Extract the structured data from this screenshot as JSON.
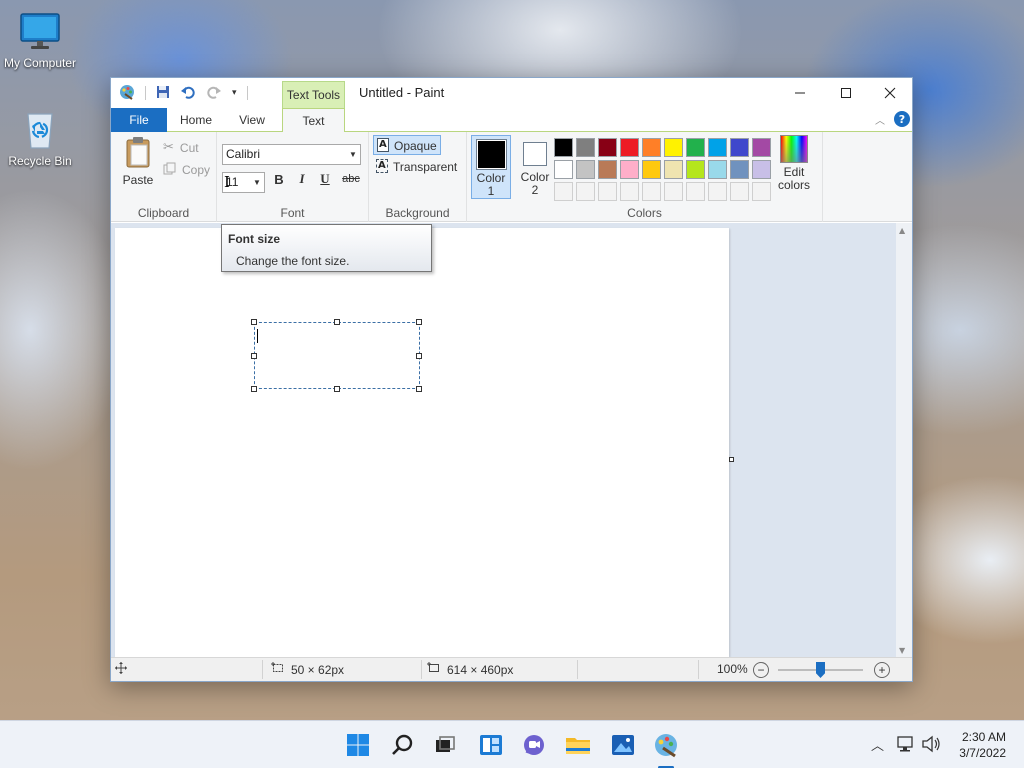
{
  "desktop": {
    "icons": [
      {
        "label": "My Computer"
      },
      {
        "label": "Recycle Bin"
      }
    ]
  },
  "window": {
    "title": "Untitled - Paint",
    "context_tab_group": "Text Tools",
    "tabs": [
      {
        "label": "File"
      },
      {
        "label": "Home"
      },
      {
        "label": "View"
      },
      {
        "label": "Text"
      }
    ],
    "active_tab": "Text"
  },
  "ribbon": {
    "clipboard": {
      "group_label": "Clipboard",
      "paste": "Paste",
      "cut": "Cut",
      "copy": "Copy"
    },
    "font": {
      "group_label": "Font",
      "family": "Calibri",
      "size": "11",
      "bold": "B",
      "italic": "I",
      "underline": "U",
      "strikethrough": "abc"
    },
    "background": {
      "group_label": "Background",
      "opaque": "Opaque",
      "transparent": "Transparent",
      "selected": "Opaque"
    },
    "colors": {
      "group_label": "Colors",
      "color1_label": "Color 1",
      "color1_line1": "Color",
      "color1_line2": "1",
      "color1_value": "#000000",
      "color2_line1": "Color",
      "color2_line2": "2",
      "color2_value": "#ffffff",
      "edit_colors_line1": "Edit",
      "edit_colors_line2": "colors",
      "palette_row1": [
        "#000000",
        "#7f7f7f",
        "#880015",
        "#ed1c24",
        "#ff7f27",
        "#fff200",
        "#22b14c",
        "#00a2e8",
        "#3f48cc",
        "#a349a4"
      ],
      "palette_row2": [
        "#ffffff",
        "#c3c3c3",
        "#b97a57",
        "#ffaec9",
        "#ffc90e",
        "#efe4b0",
        "#b5e61d",
        "#99d9ea",
        "#7092be",
        "#c8bfe7"
      ],
      "palette_row3_empty": 10
    }
  },
  "tooltip": {
    "title": "Font size",
    "description": "Change the font size."
  },
  "statusbar": {
    "selection_size": "50 × 62px",
    "image_size": "614 × 460px",
    "zoom": "100%",
    "zoom_level": 1.0
  },
  "taskbar": {
    "apps": [
      "start",
      "search",
      "task-view",
      "widgets",
      "chat",
      "file-explorer",
      "photos",
      "paint"
    ],
    "time": "2:30 AM",
    "date": "3/7/2022"
  }
}
